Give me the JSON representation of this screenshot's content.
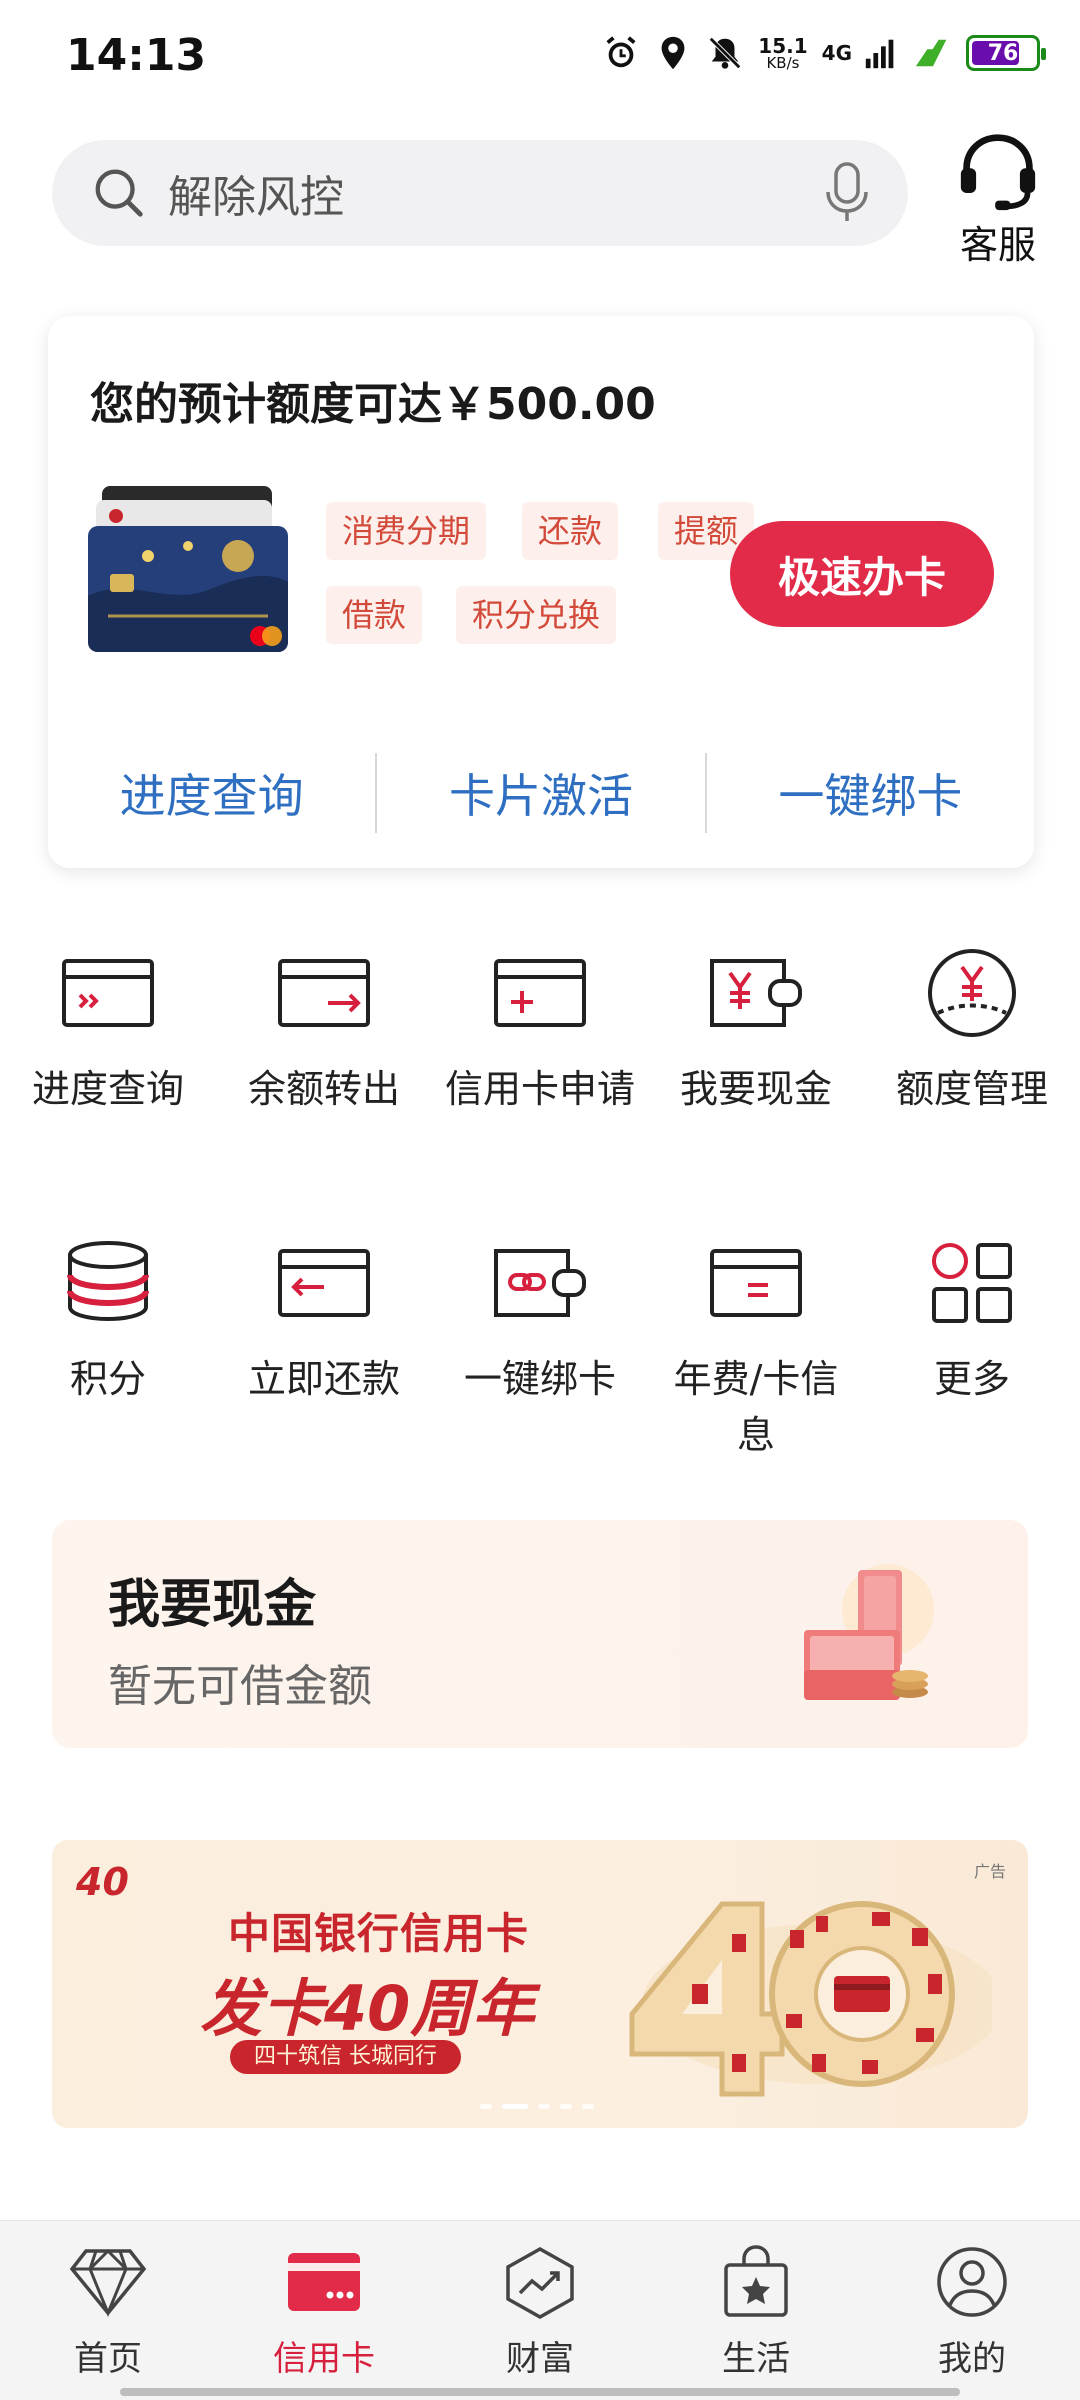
{
  "status_bar": {
    "time": "14:13",
    "speed_value": "15.1",
    "speed_unit": "KB/s",
    "network": "4G",
    "battery": "76",
    "battery_level": 0.76
  },
  "header": {
    "search_placeholder": "解除风控",
    "customer_service": "客服"
  },
  "promo": {
    "title": "您的预计额度可达￥500.00",
    "tags": [
      "消费分期",
      "还款",
      "提额",
      "借款",
      "积分兑换"
    ],
    "apply_button": "极速办卡",
    "links": [
      "进度查询",
      "卡片激活",
      "一键绑卡"
    ]
  },
  "services": [
    {
      "label": "进度查询",
      "icon": "progress-card-icon"
    },
    {
      "label": "余额转出",
      "icon": "balance-transfer-icon"
    },
    {
      "label": "信用卡申请",
      "icon": "card-apply-icon"
    },
    {
      "label": "我要现金",
      "icon": "cash-wallet-icon"
    },
    {
      "label": "额度管理",
      "icon": "limit-manage-icon"
    },
    {
      "label": "积分",
      "icon": "points-coins-icon"
    },
    {
      "label": "立即还款",
      "icon": "repay-icon"
    },
    {
      "label": "一键绑卡",
      "icon": "bind-card-icon"
    },
    {
      "label": "年费/卡信息",
      "icon": "card-info-icon"
    },
    {
      "label": "更多",
      "icon": "more-grid-icon"
    }
  ],
  "cash_banner": {
    "title": "我要现金",
    "subtitle": "暂无可借金额"
  },
  "ad": {
    "tag": "广告",
    "logo": "40",
    "line1": "中国银行信用卡",
    "line2": "发卡40周年",
    "line3": "四十筑信 长城同行"
  },
  "bottom_nav": [
    {
      "label": "首页",
      "icon": "diamond-icon",
      "active": false
    },
    {
      "label": "信用卡",
      "icon": "credit-card-icon",
      "active": true
    },
    {
      "label": "财富",
      "icon": "wealth-chart-icon",
      "active": false
    },
    {
      "label": "生活",
      "icon": "shopping-bag-icon",
      "active": false
    },
    {
      "label": "我的",
      "icon": "profile-icon",
      "active": false
    }
  ],
  "colors": {
    "accent_red": "#e12b48",
    "link_blue": "#2f6fc2",
    "tag_text": "#d34a3a",
    "tag_bg": "#fdf0ec"
  }
}
